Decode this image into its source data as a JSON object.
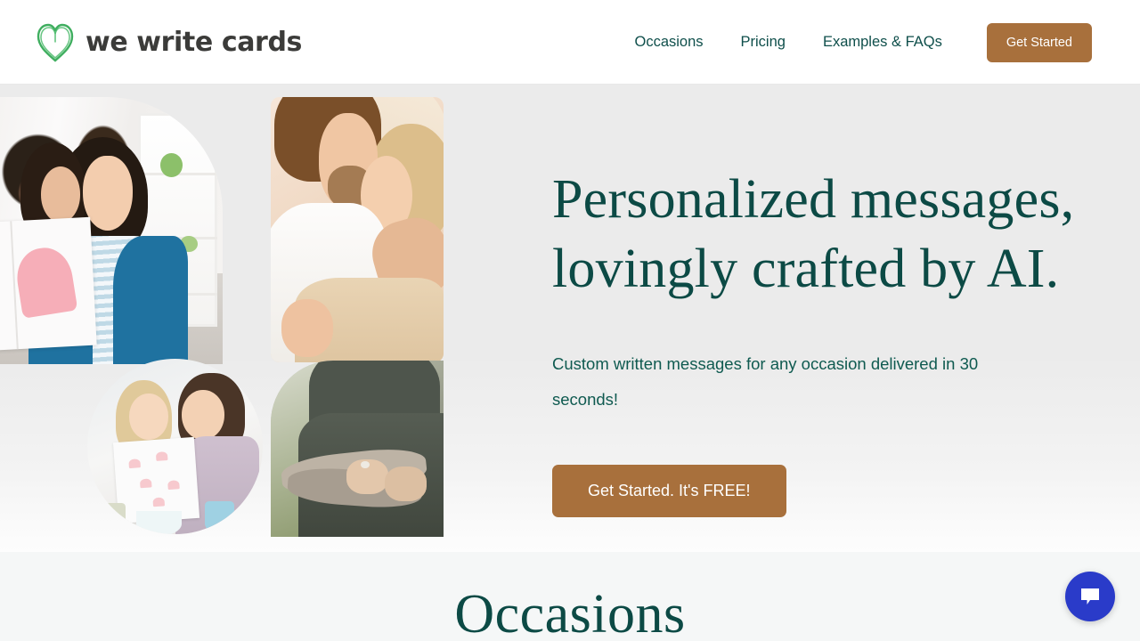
{
  "header": {
    "logo_text": "we write cards",
    "logo_icon": "heart-outline-icon",
    "nav_items": [
      {
        "label": "Occasions"
      },
      {
        "label": "Pricing"
      },
      {
        "label": "Examples & FAQs"
      }
    ],
    "cta_label": "Get Started"
  },
  "hero": {
    "title_line1": "Personalized messages,",
    "title_line2": "lovingly crafted by AI.",
    "subtitle": "Custom written messages for any occasion delivered in 30 seconds!",
    "cta_label": "Get Started. It's FREE!",
    "photos": [
      {
        "alt": "mother and daughter holding handmade heart card"
      },
      {
        "alt": "man kissing woman forehead in bed"
      },
      {
        "alt": "mother and daughter touching foreheads with card"
      },
      {
        "alt": "couple in hoodies hugging outdoors"
      }
    ]
  },
  "occasions": {
    "title": "Occasions"
  },
  "chat": {
    "icon": "chat-bubble-icon",
    "label": "Open chat"
  },
  "colors": {
    "brand_teal": "#0c4a45",
    "brand_brown": "#a8703c",
    "logo_green": "#3fae5f",
    "logo_gray": "#3b3b39",
    "hero_bg": "#ebebeb",
    "occasions_bg": "#f5f7f7",
    "chat_blue": "#2a3bc9"
  }
}
